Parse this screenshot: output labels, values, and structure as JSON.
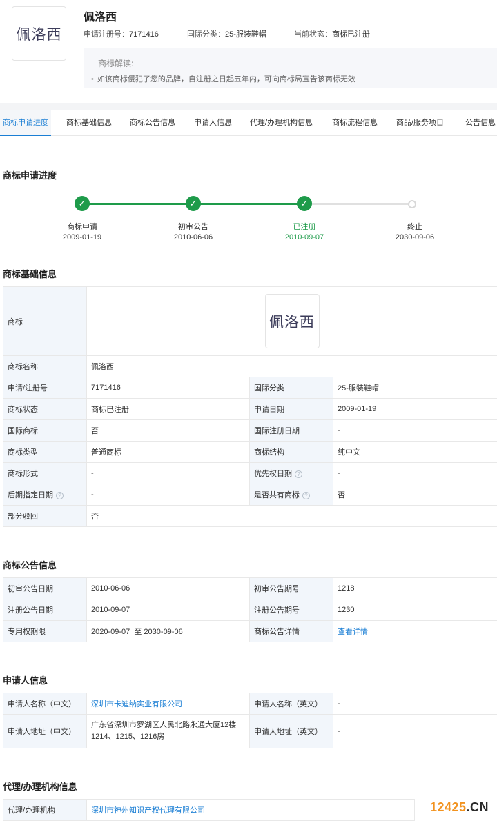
{
  "header": {
    "logo_text": "佩洛西",
    "title": "佩洛西",
    "reg_no_label": "申请注册号：",
    "reg_no": "7171416",
    "class_label": "国际分类：",
    "class_value": "25-服装鞋帽",
    "status_label": "当前状态：",
    "status_value": "商标已注册",
    "interp_title": "商标解读:",
    "interp_item": "如该商标侵犯了您的品牌，自注册之日起五年内，可向商标局宣告该商标无效"
  },
  "tabs": [
    "商标申请进度",
    "商标基础信息",
    "商标公告信息",
    "申请人信息",
    "代理/办理机构信息",
    "商标流程信息",
    "商品/服务项目",
    "公告信息"
  ],
  "progress": {
    "title": "商标申请进度",
    "steps": [
      {
        "label": "商标申请",
        "date": "2009-01-19"
      },
      {
        "label": "初审公告",
        "date": "2010-06-06"
      },
      {
        "label": "已注册",
        "date": "2010-09-07"
      },
      {
        "label": "终止",
        "date": "2030-09-06"
      }
    ]
  },
  "basic": {
    "title": "商标基础信息",
    "logo_label": "商标",
    "logo_text": "佩洛西",
    "name_label": "商标名称",
    "name_value": "佩洛西",
    "rows": [
      {
        "k1": "申请/注册号",
        "v1": "7171416",
        "k2": "国际分类",
        "v2": "25-服装鞋帽"
      },
      {
        "k1": "商标状态",
        "v1": "商标已注册",
        "k2": "申请日期",
        "v2": "2009-01-19"
      },
      {
        "k1": "国际商标",
        "v1": "否",
        "k2": "国际注册日期",
        "v2": "-"
      },
      {
        "k1": "商标类型",
        "v1": "普通商标",
        "k2": "商标结构",
        "v2": "纯中文"
      },
      {
        "k1": "商标形式",
        "v1": "-",
        "k2": "优先权日期",
        "v2": "-"
      },
      {
        "k1": "后期指定日期",
        "v1": "-",
        "k2": "是否共有商标",
        "v2": "否"
      }
    ],
    "partial_label": "部分驳回",
    "partial_value": "否"
  },
  "announce": {
    "title": "商标公告信息",
    "rows": [
      {
        "k1": "初审公告日期",
        "v1": "2010-06-06",
        "k2": "初审公告期号",
        "v2": "1218"
      },
      {
        "k1": "注册公告日期",
        "v1": "2010-09-07",
        "k2": "注册公告期号",
        "v2": "1230"
      },
      {
        "k1": "专用权期限",
        "v1": "2020-09-07  至 2030-09-06",
        "k2": "商标公告详情",
        "v2": "查看详情"
      }
    ]
  },
  "applicant": {
    "title": "申请人信息",
    "name_cn_label": "申请人名称（中文）",
    "name_cn": "深圳市卡迪纳实业有限公司",
    "name_en_label": "申请人名称（英文）",
    "name_en": "-",
    "addr_cn_label": "申请人地址（中文）",
    "addr_cn_1": "广东省深圳市罗湖区人民北路永通大厦12楼",
    "addr_cn_2": "1214、1215、1216房",
    "addr_en_label": "申请人地址（英文）",
    "addr_en": "-"
  },
  "agency": {
    "title": "代理/办理机构信息",
    "label": "代理/办理机构",
    "value": "深圳市神州知识产权代理有限公司"
  },
  "watermark": {
    "num": "12425",
    "dom": ".CN"
  },
  "colors": {
    "accent": "#1a7ed4",
    "green": "#1e9b4a",
    "header_cell": "#f2f6fb"
  }
}
